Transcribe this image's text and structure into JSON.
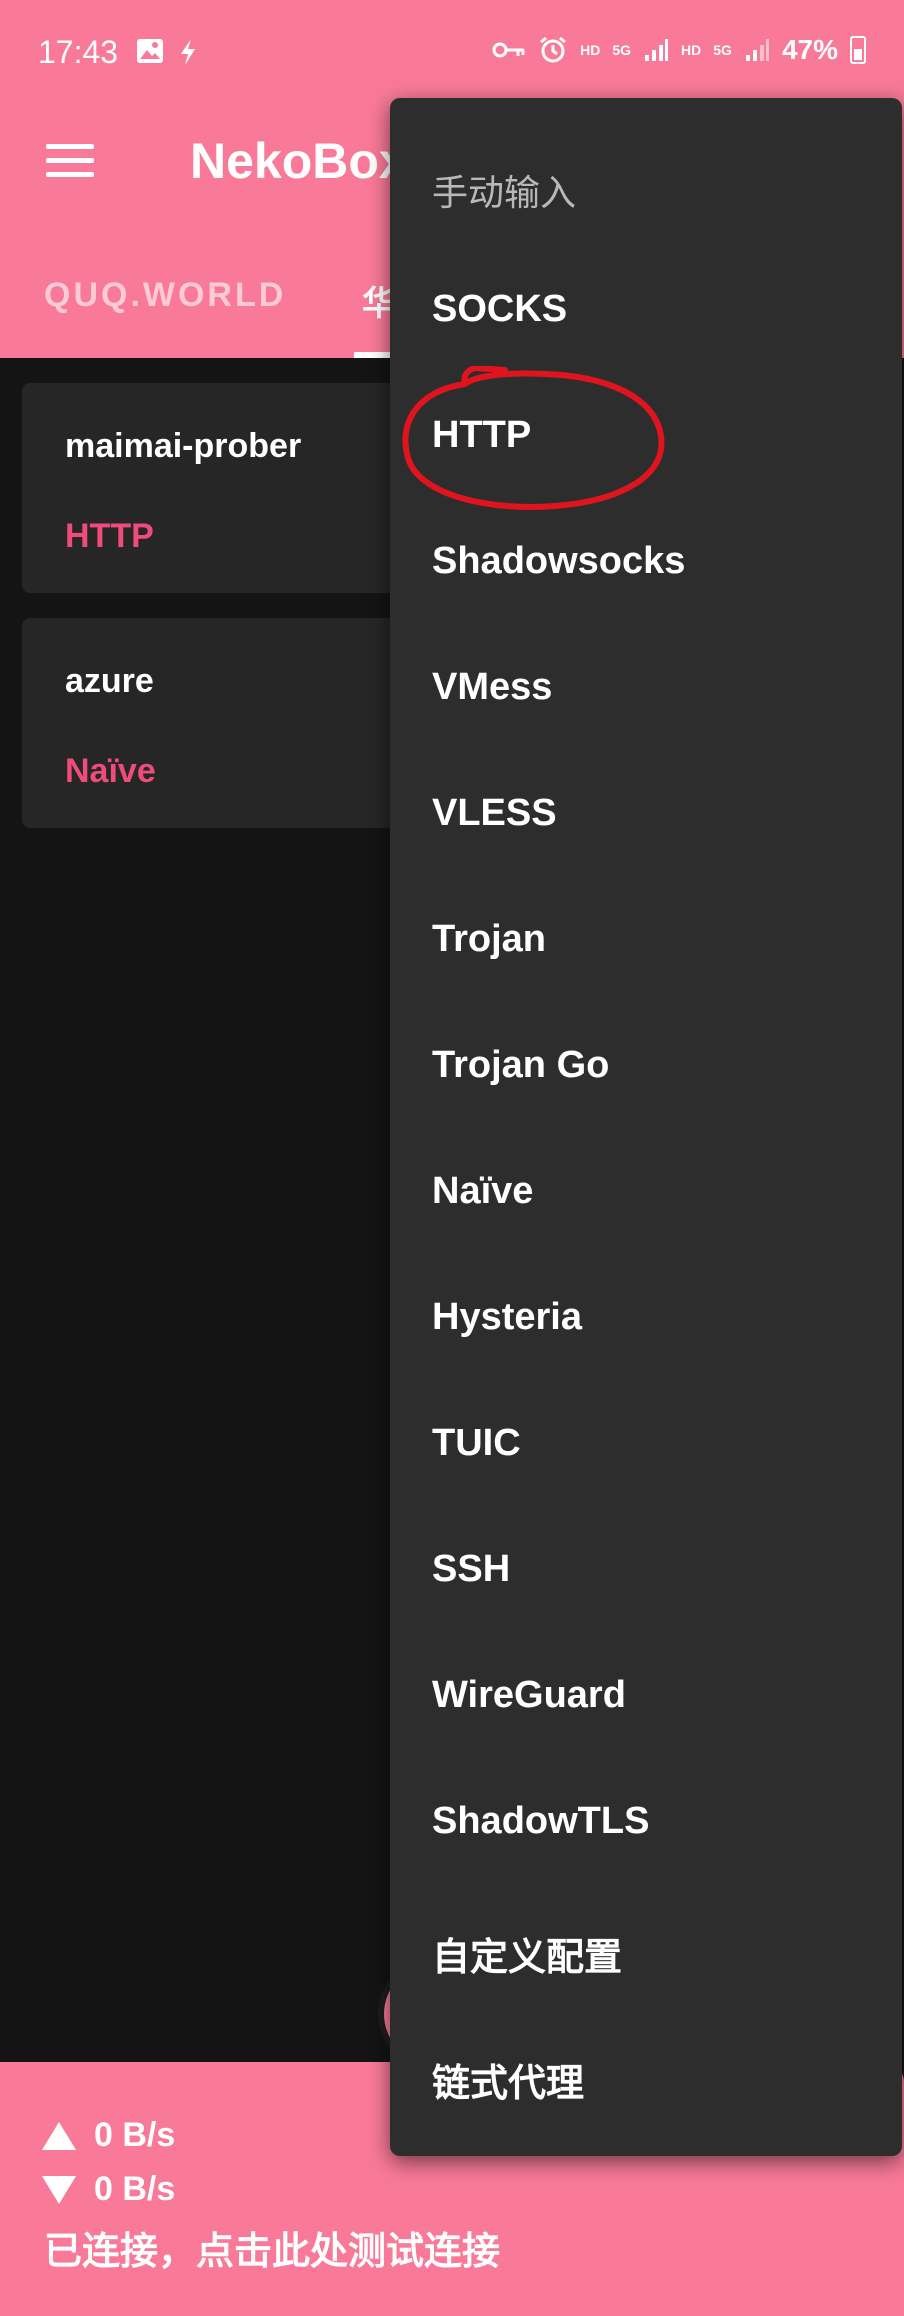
{
  "status_bar": {
    "time": "17:43",
    "hd1": "HD",
    "net1": "5G",
    "hd2": "HD",
    "net2": "5G",
    "battery": "47%",
    "icons": [
      "image-icon",
      "lightning-icon",
      "key-icon",
      "alarm-icon",
      "signal-icon",
      "battery-icon"
    ]
  },
  "app_bar": {
    "title": "NekoBox",
    "tabs": [
      {
        "label": "QUQ.WORLD"
      },
      {
        "label": "华"
      }
    ]
  },
  "profiles": [
    {
      "name": "maimai-prober",
      "type": "HTTP"
    },
    {
      "name": "azure",
      "type": "Naïve"
    }
  ],
  "popup_menu": {
    "header": "手动输入",
    "items": [
      "SOCKS",
      "HTTP",
      "Shadowsocks",
      "VMess",
      "VLESS",
      "Trojan",
      "Trojan Go",
      "Naïve",
      "Hysteria",
      "TUIC",
      "SSH",
      "WireGuard",
      "ShadowTLS",
      "自定义配置",
      "链式代理"
    ]
  },
  "bottom_bar": {
    "upload": "0 B/s",
    "download": "0 B/s",
    "status": "已连接，点击此处测试连接"
  },
  "colors": {
    "brand": "#f97a98",
    "accent": "#ef4b7c",
    "background": "#141414",
    "card": "#262626",
    "menu": "#2d2d2d",
    "annotation": "#e0141e"
  }
}
